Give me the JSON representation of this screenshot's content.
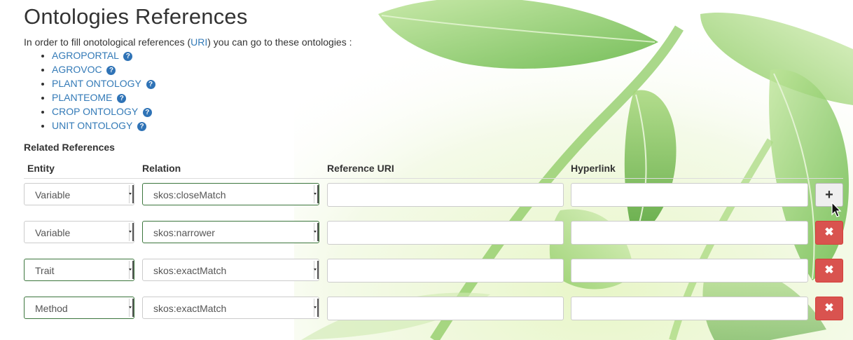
{
  "title": "Ontologies References",
  "intro": {
    "before": "In order to fill onotological references (",
    "link": "URI",
    "after": ") you can go to these ontologies :"
  },
  "ontologies": [
    {
      "label": "AGROPORTAL",
      "icon": "question-circle-icon"
    },
    {
      "label": "AGROVOC",
      "icon": "question-circle-icon"
    },
    {
      "label": "PLANT ONTOLOGY",
      "icon": "question-circle-icon"
    },
    {
      "label": "PLANTEOME",
      "icon": "question-circle-icon"
    },
    {
      "label": "CROP ONTOLOGY",
      "icon": "question-circle-icon"
    },
    {
      "label": "UNIT ONTOLOGY",
      "icon": "question-circle-icon"
    }
  ],
  "question_glyph": "?",
  "related": {
    "heading": "Related References",
    "columns": {
      "entity": "Entity",
      "relation": "Relation",
      "uri": "Reference URI",
      "hyperlink": "Hyperlink"
    },
    "rows": [
      {
        "entity": "Variable",
        "relation": "skos:closeMatch",
        "uri": "",
        "hyperlink": "",
        "action": "add",
        "action_glyph": "+"
      },
      {
        "entity": "Variable",
        "relation": "skos:narrower",
        "uri": "",
        "hyperlink": "",
        "action": "remove",
        "action_glyph": "✖"
      },
      {
        "entity": "Trait",
        "relation": "skos:exactMatch",
        "uri": "",
        "hyperlink": "",
        "action": "remove",
        "action_glyph": "✖"
      },
      {
        "entity": "Method",
        "relation": "skos:exactMatch",
        "uri": "",
        "hyperlink": "",
        "action": "remove",
        "action_glyph": "✖"
      }
    ]
  },
  "colors": {
    "link": "#337ab7",
    "icon": "#2f73b6",
    "danger": "#d9534f",
    "focus_border": "#3c763d"
  }
}
